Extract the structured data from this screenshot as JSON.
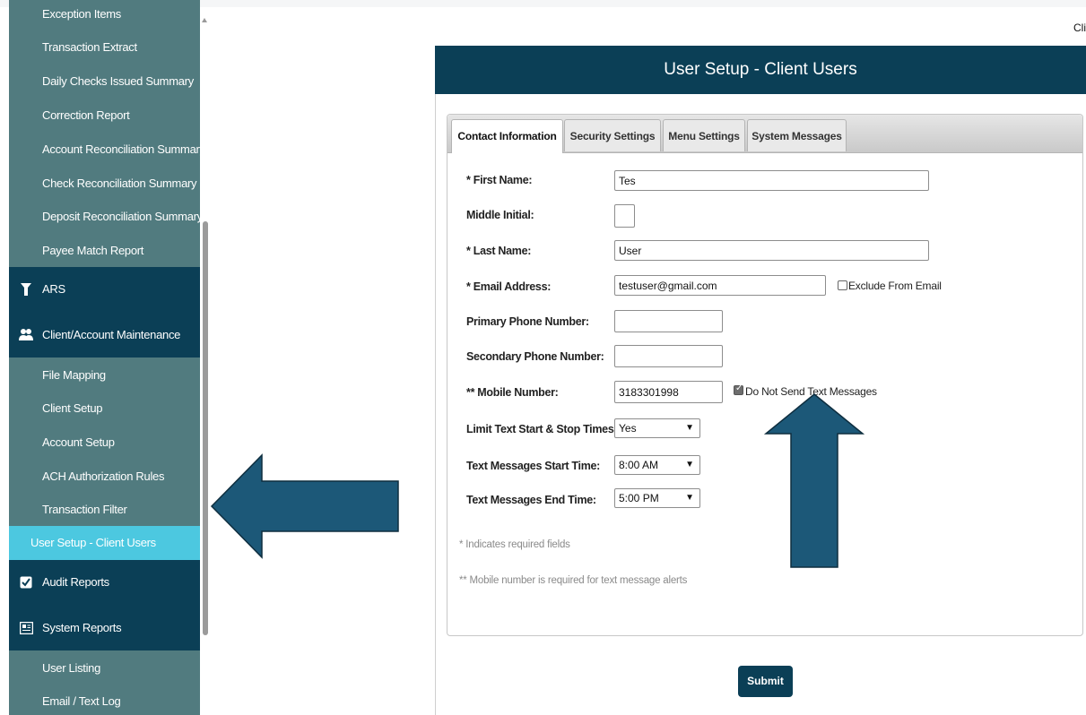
{
  "sidebar": {
    "items_top": [
      {
        "label": "Exception Items"
      },
      {
        "label": "Transaction Extract"
      },
      {
        "label": "Daily Checks Issued Summary"
      },
      {
        "label": "Correction Report"
      },
      {
        "label": "Account Reconciliation Summary"
      },
      {
        "label": "Check Reconciliation Summary"
      },
      {
        "label": "Deposit Reconciliation Summary"
      },
      {
        "label": "Payee Match Report"
      }
    ],
    "section_ars": {
      "label": "ARS",
      "icon": "ars-icon"
    },
    "section_client": {
      "label": "Client/Account Maintenance",
      "icon": "users-icon"
    },
    "items_client": [
      {
        "label": "File Mapping"
      },
      {
        "label": "Client Setup"
      },
      {
        "label": "Account Setup"
      },
      {
        "label": "ACH Authorization Rules"
      },
      {
        "label": "Transaction Filter"
      },
      {
        "label": "User Setup - Client Users"
      }
    ],
    "section_audit": {
      "label": "Audit Reports",
      "icon": "checkbox-icon"
    },
    "section_system": {
      "label": "System Reports",
      "icon": "report-icon"
    },
    "items_system": [
      {
        "label": "User Listing"
      },
      {
        "label": "Email / Text Log"
      }
    ]
  },
  "topright_text": "Cli",
  "panel": {
    "title": "User Setup - Client Users"
  },
  "tabs": [
    {
      "label": "Contact Information"
    },
    {
      "label": "Security Settings"
    },
    {
      "label": "Menu Settings"
    },
    {
      "label": "System Messages"
    }
  ],
  "form": {
    "first_name": {
      "label": "* First Name:",
      "value": "Tes"
    },
    "middle_initial": {
      "label": "Middle Initial:",
      "value": ""
    },
    "last_name": {
      "label": "* Last Name:",
      "value": "User"
    },
    "email": {
      "label": "* Email Address:",
      "value": "testuser@gmail.com",
      "exclude_label": "Exclude From Email",
      "exclude_checked": false
    },
    "primary_phone": {
      "label": "Primary Phone Number:",
      "value": ""
    },
    "secondary_phone": {
      "label": "Secondary Phone Number:",
      "value": ""
    },
    "mobile": {
      "label": "** Mobile Number:",
      "value": "3183301998",
      "no_text_label": "Do Not Send Text Messages",
      "no_text_checked": true
    },
    "limit_text": {
      "label": "Limit Text Start & Stop Times:",
      "value": "Yes"
    },
    "start_time": {
      "label": "Text Messages Start Time:",
      "value": "8:00 AM"
    },
    "end_time": {
      "label": "Text Messages End Time:",
      "value": "5:00 PM"
    }
  },
  "notes": {
    "required": "* Indicates required fields",
    "mobile_required": "** Mobile number is required for text message alerts"
  },
  "submit_label": "Submit",
  "colors": {
    "sidebar_bg": "#517b7f",
    "section_bg": "#0b3f56",
    "active_item": "#4cc8e0",
    "header_bg": "#0b3f56",
    "arrow_fill": "#1c5878"
  },
  "annotations": {
    "arrows": [
      "left-pointing-arrow",
      "up-pointing-arrow"
    ]
  }
}
